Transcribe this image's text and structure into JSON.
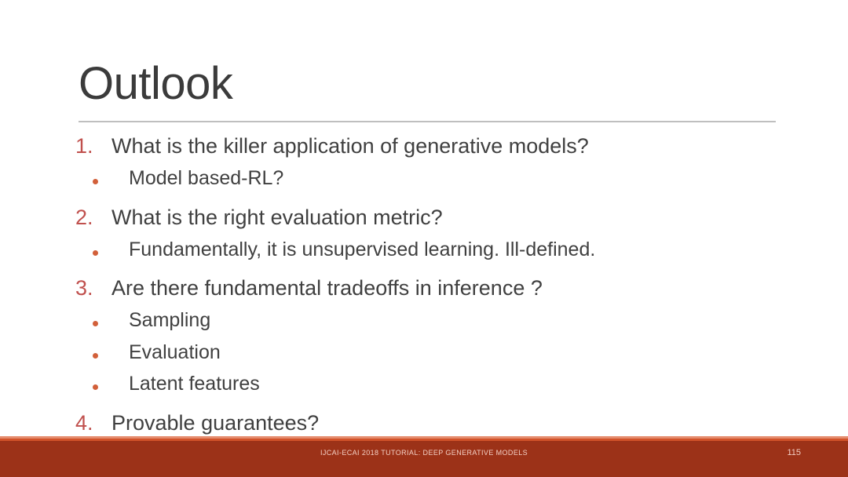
{
  "slide": {
    "title": "Outlook",
    "colors": {
      "title_text": "#3b3b3b",
      "body_text": "#404040",
      "number_marker": "#c0504d",
      "bullet_dot": "#d2603a",
      "divider": "#bfbfbf",
      "footer_bar": "#9c3218",
      "footer_stripe": "#d2522a",
      "footer_text": "#f3cfc4"
    },
    "items": [
      {
        "number": "1.",
        "text": "What is the killer application of generative models?",
        "subs": [
          {
            "bullet": "bullet-dot",
            "text": "Model based-RL?"
          }
        ]
      },
      {
        "number": "2.",
        "text": "What is the right evaluation metric?",
        "subs": [
          {
            "bullet": "bullet-dot",
            "text": "Fundamentally, it is unsupervised learning. Ill-defined."
          }
        ]
      },
      {
        "number": "3.",
        "text": "Are there fundamental tradeoffs in inference ?",
        "subs": [
          {
            "bullet": "bullet-dot",
            "text": "Sampling"
          },
          {
            "bullet": "bullet-dot",
            "text": "Evaluation"
          },
          {
            "bullet": "bullet-dot",
            "text": "Latent features"
          }
        ]
      },
      {
        "number": "4.",
        "text": "Provable guarantees?",
        "subs": []
      }
    ],
    "footer": {
      "title": "IJCAI-ECAI 2018 TUTORIAL: DEEP GENERATIVE MODELS",
      "page_number": "115"
    }
  }
}
